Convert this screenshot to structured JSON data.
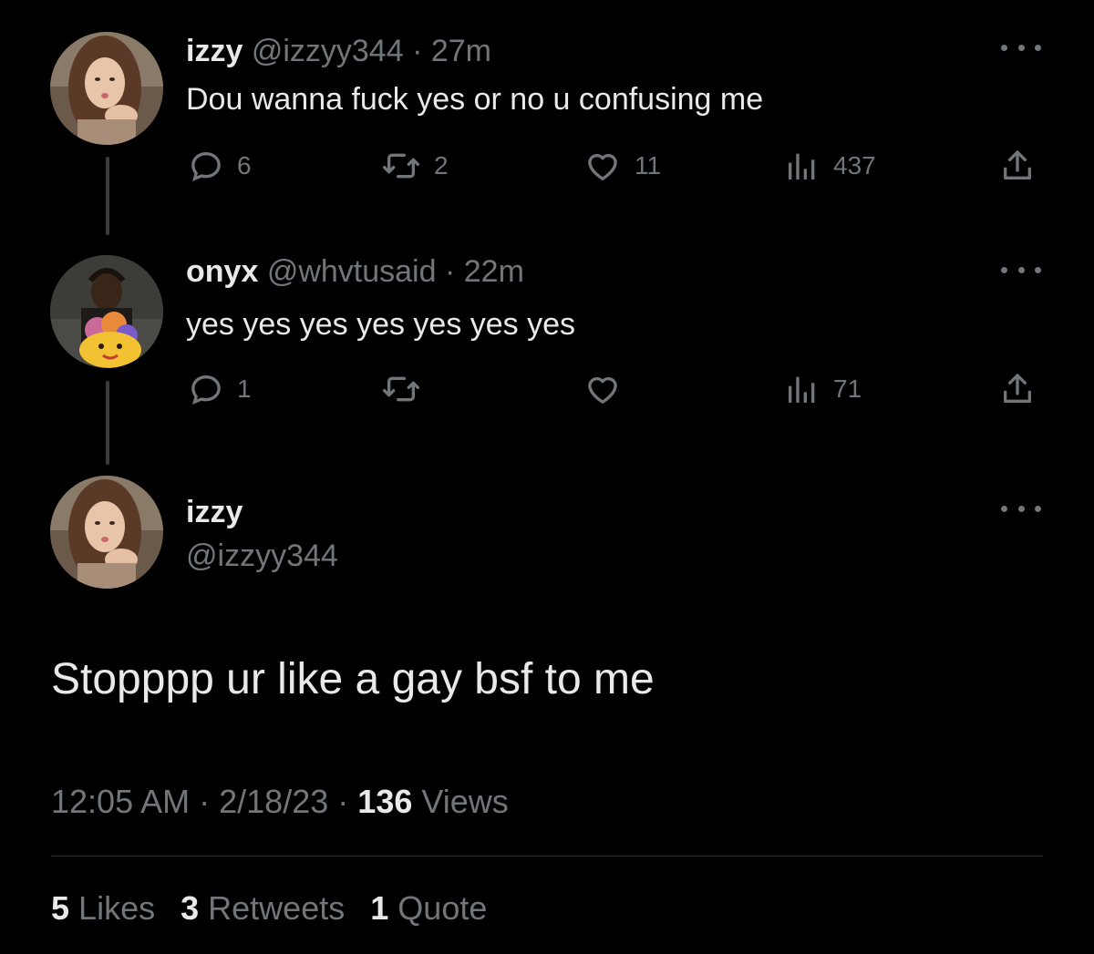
{
  "colors": {
    "background": "#000000",
    "primary_text": "#e7e9ea",
    "secondary_text": "#71767b",
    "thread_line": "#3a3d40"
  },
  "tweets": [
    {
      "name": "izzy",
      "handle": "@izzyy344",
      "separator": "·",
      "time": "27m",
      "text": "Dou wanna fuck yes or no u confusing me",
      "replies": "6",
      "retweets": "2",
      "likes": "11",
      "views": "437"
    },
    {
      "name": "onyx",
      "handle": "@whvtusaid",
      "separator": "·",
      "time": "22m",
      "text": "yes yes yes yes yes yes yes",
      "replies": "1",
      "retweets": "",
      "likes": "",
      "views": "71"
    }
  ],
  "main_tweet": {
    "name": "izzy",
    "handle": "@izzyy344",
    "text": "Stopppp ur like a gay bsf to me",
    "time": "12:05 AM",
    "separator": "·",
    "date": "2/18/23",
    "views_count": "136",
    "views_label": "Views",
    "likes_count": "5",
    "likes_label": "Likes",
    "retweets_count": "3",
    "retweets_label": "Retweets",
    "quotes_count": "1",
    "quotes_label": "Quote"
  },
  "icons": {
    "reply": "reply-icon",
    "retweet": "retweet-icon",
    "like": "heart-icon",
    "views": "views-icon",
    "share": "share-icon",
    "more": "more-icon"
  }
}
